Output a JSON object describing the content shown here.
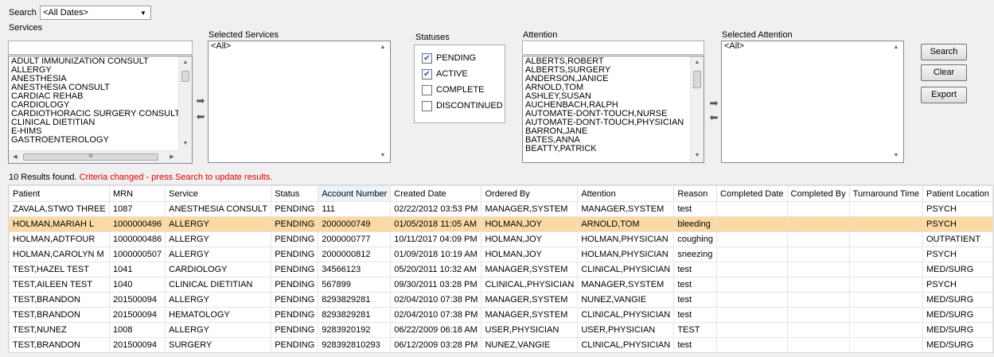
{
  "search": {
    "label": "Search",
    "date_value": "<All Dates>"
  },
  "services": {
    "label": "Services",
    "filter_value": "",
    "items": [
      "ADULT IMMUNIZATION CONSULT",
      "ALLERGY",
      "ANESTHESIA",
      "ANESTHESIA CONSULT",
      "CARDIAC REHAB",
      "CARDIOLOGY",
      "CARDIOTHORACIC SURGERY CONSULT",
      "CLINICAL DIETITIAN",
      "E-HIMS",
      "GASTROENTEROLOGY"
    ]
  },
  "selected_services": {
    "label": "Selected Services",
    "items": [
      "<All>"
    ]
  },
  "statuses": {
    "label": "Statuses",
    "items": [
      {
        "label": "PENDING",
        "checked": true
      },
      {
        "label": "ACTIVE",
        "checked": true
      },
      {
        "label": "COMPLETE",
        "checked": false
      },
      {
        "label": "DISCONTINUED",
        "checked": false
      }
    ]
  },
  "attention": {
    "label": "Attention",
    "filter_value": "",
    "items": [
      "ALBERTS,ROBERT",
      "ALBERTS,SURGERY",
      "ANDERSON,JANICE",
      "ARNOLD,TOM",
      "ASHLEY,SUSAN",
      "AUCHENBACH,RALPH",
      "AUTOMATE-DONT-TOUCH,NURSE",
      "AUTOMATE-DONT-TOUCH,PHYSICIAN",
      "BARRON,JANE",
      "BATES,ANNA",
      "BEATTY,PATRICK"
    ]
  },
  "selected_attention": {
    "label": "Selected Attention",
    "items": [
      "<All>"
    ]
  },
  "buttons": {
    "search": "Search",
    "clear": "Clear",
    "export": "Export"
  },
  "results": {
    "count_text": "10 Results found.",
    "warning_text": "Criteria changed - press Search to update results."
  },
  "grid": {
    "columns": [
      "Patient",
      "MRN",
      "Service",
      "Status",
      "Account Number",
      "Created Date",
      "Ordered By",
      "Attention",
      "Reason",
      "Completed Date",
      "Completed By",
      "Turnaround Time",
      "Patient Location"
    ],
    "sorted_column": "Account Number",
    "selected_row": 1,
    "rows": [
      [
        "ZAVALA,STWO THREE",
        "1087",
        "ANESTHESIA CONSULT",
        "PENDING",
        "111",
        "02/22/2012 03:53 PM",
        "MANAGER,SYSTEM",
        "MANAGER,SYSTEM",
        "test",
        "",
        "",
        "",
        "PSYCH"
      ],
      [
        "HOLMAN,MARIAH L",
        "1000000496",
        "ALLERGY",
        "PENDING",
        "2000000749",
        "01/05/2018 11:05 AM",
        "HOLMAN,JOY",
        "ARNOLD,TOM",
        "bleeding",
        "",
        "",
        "",
        "PSYCH"
      ],
      [
        "HOLMAN,ADTFOUR",
        "1000000486",
        "ALLERGY",
        "PENDING",
        "2000000777",
        "10/11/2017 04:09 PM",
        "HOLMAN,JOY",
        "HOLMAN,PHYSICIAN",
        "coughing",
        "",
        "",
        "",
        "OUTPATIENT"
      ],
      [
        "HOLMAN,CAROLYN M",
        "1000000507",
        "ALLERGY",
        "PENDING",
        "2000000812",
        "01/09/2018 10:19 AM",
        "HOLMAN,JOY",
        "HOLMAN,PHYSICIAN",
        "sneezing",
        "",
        "",
        "",
        "PSYCH"
      ],
      [
        "TEST,HAZEL TEST",
        "1041",
        "CARDIOLOGY",
        "PENDING",
        "34566123",
        "05/20/2011 10:32 AM",
        "MANAGER,SYSTEM",
        "CLINICAL,PHYSICIAN",
        "test",
        "",
        "",
        "",
        "MED/SURG"
      ],
      [
        "TEST,AILEEN TEST",
        "1040",
        "CLINICAL DIETITIAN",
        "PENDING",
        "567899",
        "09/30/2011 03:28 PM",
        "CLINICAL,PHYSICIAN",
        "MANAGER,SYSTEM",
        "test",
        "",
        "",
        "",
        "PSYCH"
      ],
      [
        "TEST,BRANDON",
        "201500094",
        "ALLERGY",
        "PENDING",
        "8293829281",
        "02/04/2010 07:38 PM",
        "MANAGER,SYSTEM",
        "NUNEZ,VANGIE",
        "test",
        "",
        "",
        "",
        "MED/SURG"
      ],
      [
        "TEST,BRANDON",
        "201500094",
        "HEMATOLOGY",
        "PENDING",
        "8293829281",
        "02/04/2010 07:38 PM",
        "MANAGER,SYSTEM",
        "CLINICAL,PHYSICIAN",
        "test",
        "",
        "",
        "",
        "MED/SURG"
      ],
      [
        "TEST,NUNEZ",
        "1008",
        "ALLERGY",
        "PENDING",
        "9283920192",
        "06/22/2009 06:18 AM",
        "USER,PHYSICIAN",
        "USER,PHYSICIAN",
        "TEST",
        "",
        "",
        "",
        "MED/SURG"
      ],
      [
        "TEST,BRANDON",
        "201500094",
        "SURGERY",
        "PENDING",
        "928392810293",
        "06/12/2009 03:28 PM",
        "NUNEZ,VANGIE",
        "CLINICAL,PHYSICIAN",
        "test",
        "",
        "",
        "",
        "MED/SURG"
      ]
    ]
  }
}
